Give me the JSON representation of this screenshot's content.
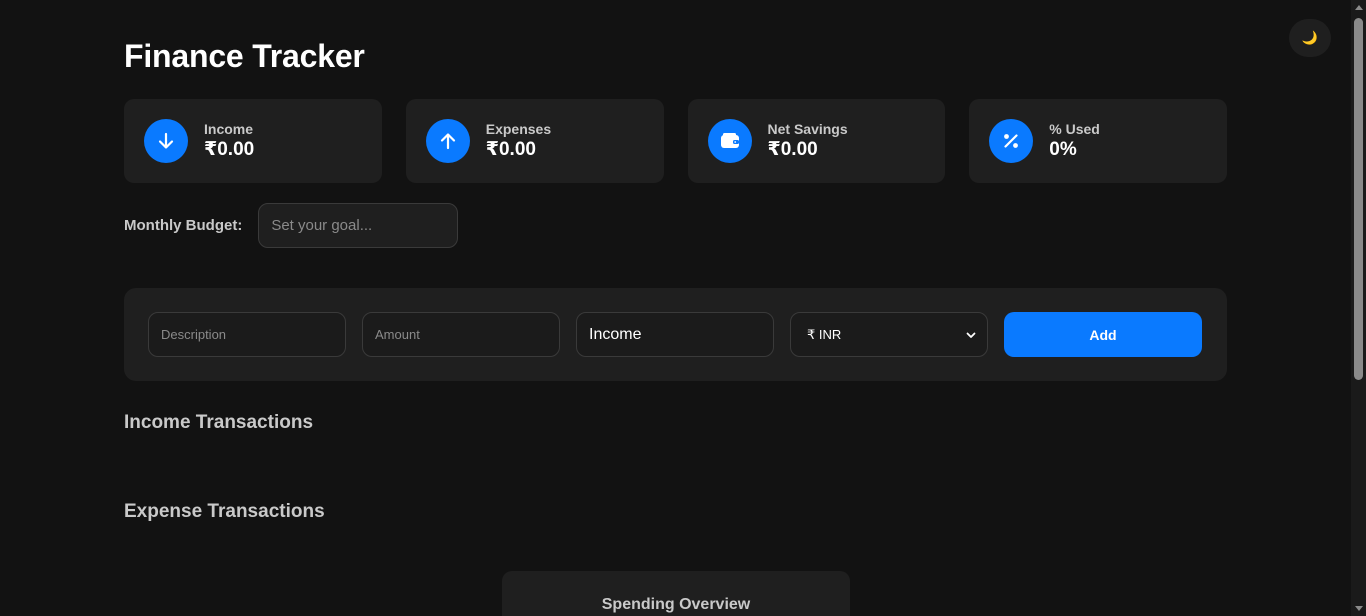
{
  "app": {
    "title": "Finance Tracker",
    "theme_toggle_icon": "🌙"
  },
  "summary_cards": [
    {
      "icon": "arrow-down-icon",
      "label": "Income",
      "value": "₹0.00"
    },
    {
      "icon": "arrow-up-icon",
      "label": "Expenses",
      "value": "₹0.00"
    },
    {
      "icon": "wallet-icon",
      "label": "Net Savings",
      "value": "₹0.00"
    },
    {
      "icon": "percent-icon",
      "label": "% Used",
      "value": "0%"
    }
  ],
  "budget": {
    "label": "Monthly Budget:",
    "placeholder": "Set your goal...",
    "value": ""
  },
  "form": {
    "description_placeholder": "Description",
    "amount_placeholder": "Amount",
    "type_value": "Income",
    "currency_value": "₹ INR",
    "add_label": "Add"
  },
  "sections": {
    "income_heading": "Income Transactions",
    "expense_heading": "Expense Transactions",
    "overview_heading": "Spending Overview"
  },
  "colors": {
    "accent": "#0a7aff",
    "background": "#121212",
    "card": "#1f1f1f"
  }
}
